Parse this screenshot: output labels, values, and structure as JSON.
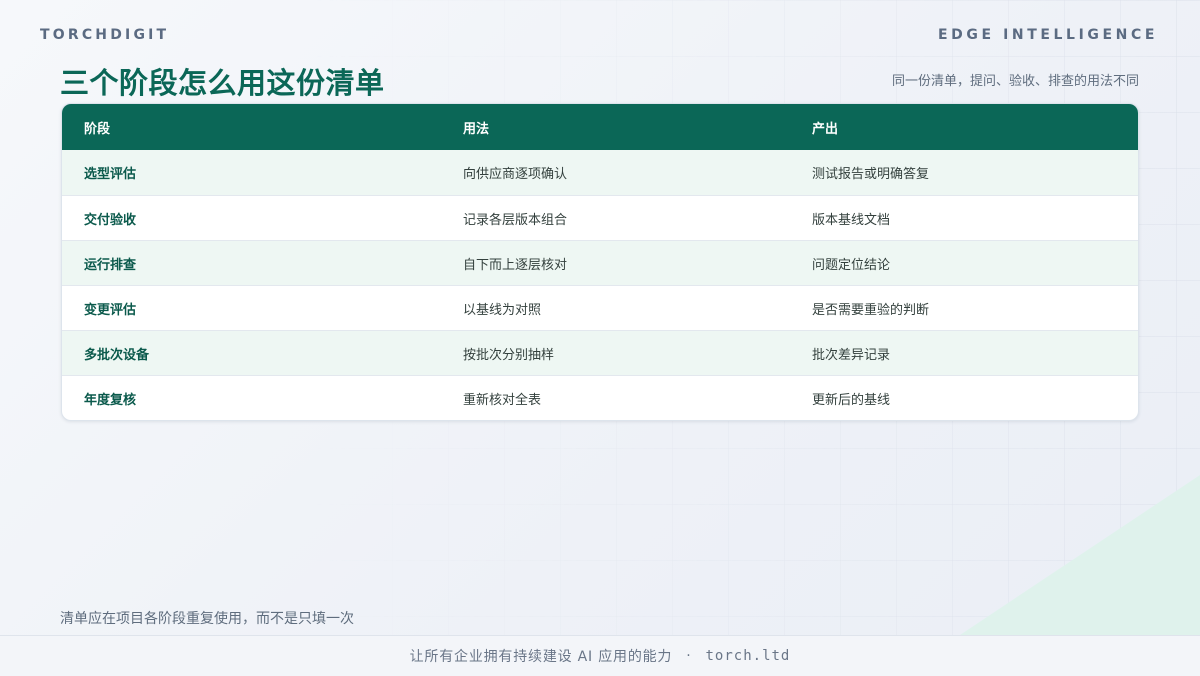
{
  "header": {
    "brand_left": "TORCHDIGIT",
    "brand_right": "EDGE INTELLIGENCE"
  },
  "title": "三个阶段怎么用这份清单",
  "subtitle": "同一份清单，提问、验收、排查的用法不同",
  "table": {
    "columns": [
      "阶段",
      "用法",
      "产出"
    ],
    "rows": [
      {
        "stage": "选型评估",
        "usage": "向供应商逐项确认",
        "output": "测试报告或明确答复"
      },
      {
        "stage": "交付验收",
        "usage": "记录各层版本组合",
        "output": "版本基线文档"
      },
      {
        "stage": "运行排查",
        "usage": "自下而上逐层核对",
        "output": "问题定位结论"
      },
      {
        "stage": "变更评估",
        "usage": "以基线为对照",
        "output": "是否需要重验的判断"
      },
      {
        "stage": "多批次设备",
        "usage": "按批次分别抽样",
        "output": "批次差异记录"
      },
      {
        "stage": "年度复核",
        "usage": "重新核对全表",
        "output": "更新后的基线"
      }
    ]
  },
  "footnote": "清单应在项目各阶段重复使用，而不是只填一次",
  "footer": {
    "slogan": "让所有企业拥有持续建设 AI 应用的能力",
    "separator": "·",
    "url": "torch.ltd"
  },
  "colors": {
    "accent": "#0b6757",
    "row_alt": "#eef7f3",
    "muted_text": "#5f6d7e"
  }
}
